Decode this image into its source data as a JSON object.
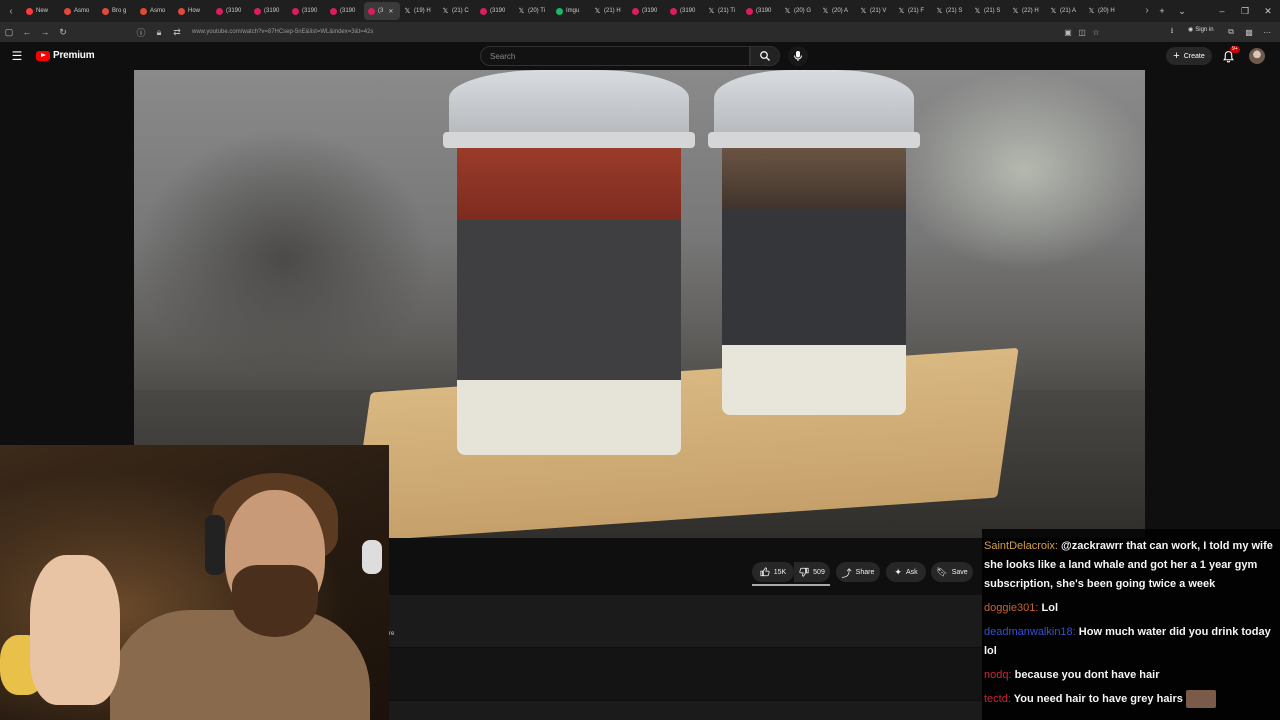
{
  "browser": {
    "tabs": [
      {
        "label": "New",
        "fav_color": "#ff3b3b",
        "x": false
      },
      {
        "label": "Asmo",
        "fav_color": "#e04a3a",
        "x": false
      },
      {
        "label": "Bro g",
        "fav_color": "#e04a3a",
        "x": false
      },
      {
        "label": "Asmo",
        "fav_color": "#e04a3a",
        "x": false
      },
      {
        "label": "How",
        "fav_color": "#e04a3a",
        "x": false
      },
      {
        "label": "(3190",
        "fav_color": "#d81e5b",
        "x": false
      },
      {
        "label": "(3190",
        "fav_color": "#d81e5b",
        "x": false
      },
      {
        "label": "(3190",
        "fav_color": "#d81e5b",
        "x": false
      },
      {
        "label": "(3190",
        "fav_color": "#d81e5b",
        "x": false
      },
      {
        "label": "(3",
        "fav_color": "#d81e5b",
        "x": false,
        "active": true
      },
      {
        "label": "(19) H",
        "fav_color": "",
        "x": true
      },
      {
        "label": "(21) C",
        "fav_color": "",
        "x": true
      },
      {
        "label": "(3190",
        "fav_color": "#d81e5b",
        "x": false
      },
      {
        "label": "(20) Ti",
        "fav_color": "",
        "x": true
      },
      {
        "label": "Imgu",
        "fav_color": "#1bb76e",
        "x": false
      },
      {
        "label": "(21) H",
        "fav_color": "",
        "x": true
      },
      {
        "label": "(3190",
        "fav_color": "#d81e5b",
        "x": false
      },
      {
        "label": "(3190",
        "fav_color": "#d81e5b",
        "x": false
      },
      {
        "label": "(21) Ti",
        "fav_color": "",
        "x": true
      },
      {
        "label": "(3190",
        "fav_color": "#d81e5b",
        "x": false
      },
      {
        "label": "(20) G",
        "fav_color": "",
        "x": true
      },
      {
        "label": "(20) A",
        "fav_color": "",
        "x": true
      },
      {
        "label": "(21) V",
        "fav_color": "",
        "x": true
      },
      {
        "label": "(21) F",
        "fav_color": "",
        "x": true
      },
      {
        "label": "(21) S",
        "fav_color": "",
        "x": true
      },
      {
        "label": "(21) S",
        "fav_color": "",
        "x": true
      },
      {
        "label": "(22) H",
        "fav_color": "",
        "x": true
      },
      {
        "label": "(21) A",
        "fav_color": "",
        "x": true
      },
      {
        "label": "(20) H",
        "fav_color": "",
        "x": true
      }
    ],
    "new_tab_label": "+",
    "tab_list_label": "⌄",
    "minimize_label": "–",
    "restore_label": "❐",
    "close_label": "✕",
    "url": "www.youtube.com/watch?v=87HCsep-5nE&list=WL&index=3&t=42s",
    "sign_in_label": "Sign in"
  },
  "youtube": {
    "logo_label": "Premium",
    "search_placeholder": "Search",
    "create_label": "Create",
    "notification_count": "9+",
    "actions": {
      "like_count": "15K",
      "dislike_count": "509",
      "share_label": "Share",
      "ask_label": "Ask",
      "save_label": "Save"
    },
    "description_stub": "re"
  },
  "chat": {
    "messages": [
      {
        "user": "SaintDelacroix:",
        "user_color": "#d4a04a",
        "text": "@zackrawrr that can work, I told my wife she looks like a land whale and got her a 1 year gym subscription, she's been going twice a week"
      },
      {
        "user": "doggie301:",
        "user_color": "#c8642f",
        "text": "Lol"
      },
      {
        "user": "deadmanwalkin18:",
        "user_color": "#3a4fd0",
        "text": "How much water did you drink today lol"
      },
      {
        "user": "nodq:",
        "user_color": "#d0243a",
        "text": "because you dont have hair"
      },
      {
        "user": "tectd:",
        "user_color": "#c8243a",
        "text": "You need hair to have grey hairs",
        "has_emote": true
      }
    ]
  },
  "colors": {
    "yt_red": "#ff0000",
    "bg": "#0f0f0f"
  }
}
